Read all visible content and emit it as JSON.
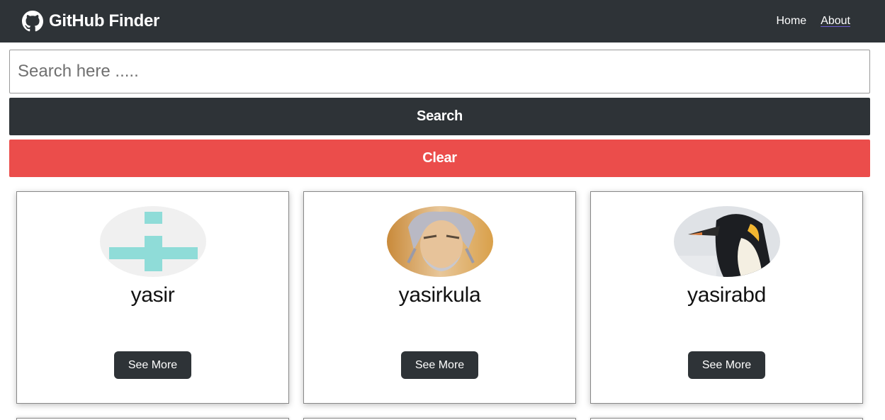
{
  "navbar": {
    "brand_icon": "github-icon",
    "title": "GitHub Finder",
    "links": [
      "Home",
      "About"
    ]
  },
  "search": {
    "placeholder": "Search here .....",
    "value": "",
    "search_label": "Search",
    "clear_label": "Clear"
  },
  "users": [
    {
      "login": "yasir",
      "avatar": "identicon-avatar",
      "button_label": "See More"
    },
    {
      "login": "yasirkula",
      "avatar": "anime-old-man-avatar",
      "button_label": "See More"
    },
    {
      "login": "yasirabd",
      "avatar": "penguin-avatar",
      "button_label": "See More"
    }
  ],
  "colors": {
    "navbar": "#2e3337",
    "dark_button": "#2e3337",
    "clear_button": "#eb4d4b",
    "identicon": "#8fdcd8"
  }
}
